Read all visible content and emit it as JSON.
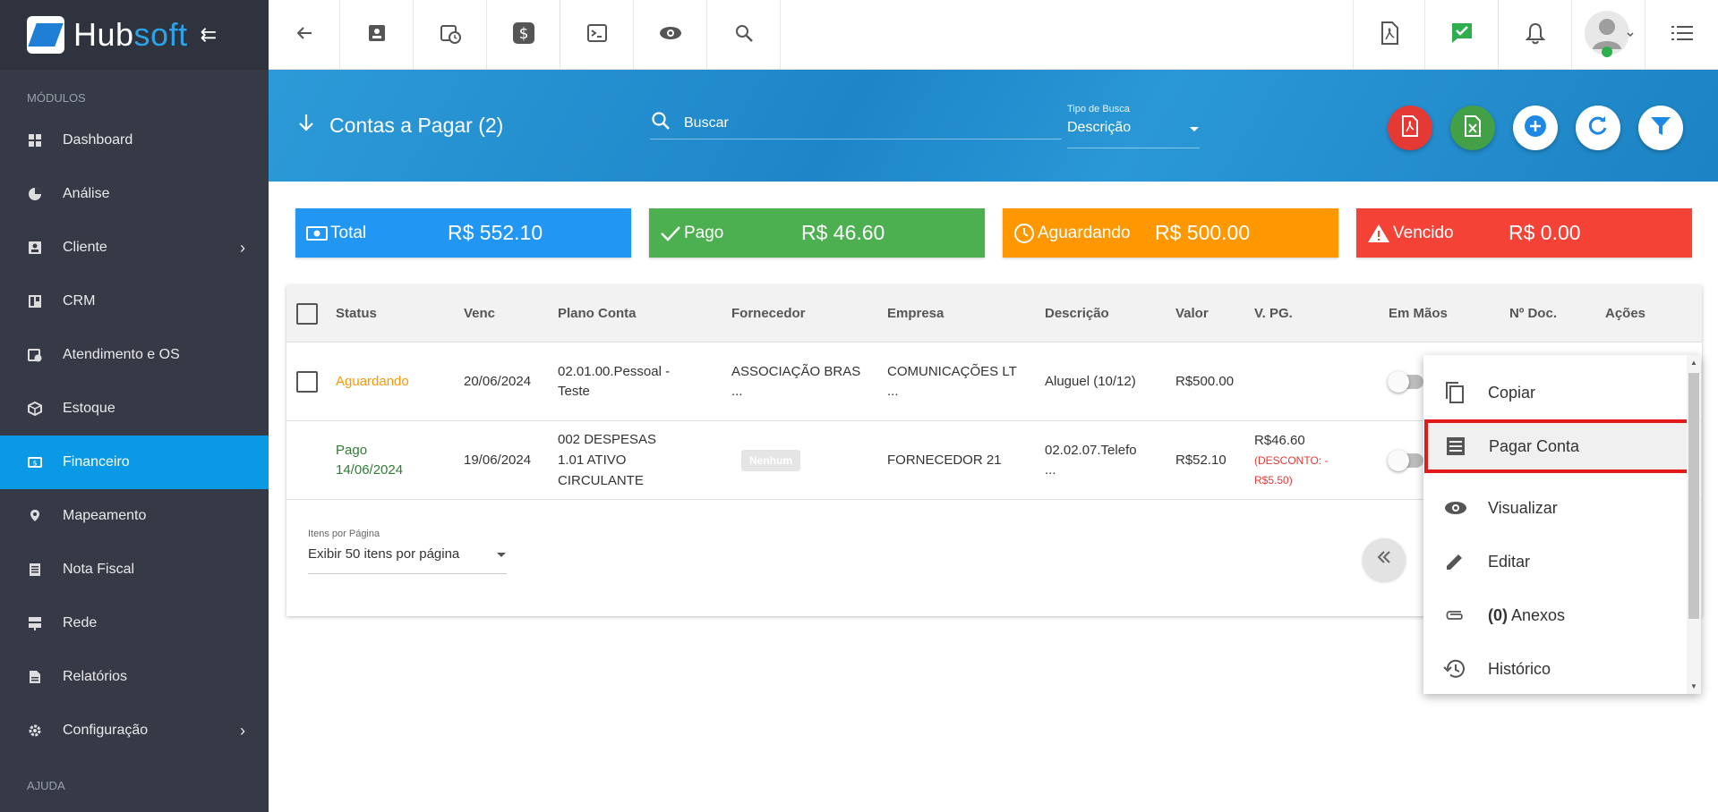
{
  "brand": {
    "name_a": "Hub",
    "name_b": "soft",
    "colors": {
      "sidebar": "#353a46",
      "active": "#0a9ae5",
      "header": "#2290d2"
    }
  },
  "sidebar": {
    "section_modules": "MÓDULOS",
    "section_help": "AJUDA",
    "items": [
      {
        "label": "Dashboard",
        "icon": "dashboard-icon"
      },
      {
        "label": "Análise",
        "icon": "pie-chart-icon"
      },
      {
        "label": "Cliente",
        "icon": "contact-card-icon",
        "has_children": true
      },
      {
        "label": "CRM",
        "icon": "crm-board-icon"
      },
      {
        "label": "Atendimento e OS",
        "icon": "calendar-clock-icon"
      },
      {
        "label": "Estoque",
        "icon": "box-icon"
      },
      {
        "label": "Financeiro",
        "icon": "money-icon",
        "active": true
      },
      {
        "label": "Mapeamento",
        "icon": "map-pin-icon"
      },
      {
        "label": "Nota Fiscal",
        "icon": "invoice-icon"
      },
      {
        "label": "Rede",
        "icon": "network-icon"
      },
      {
        "label": "Relatórios",
        "icon": "report-icon"
      },
      {
        "label": "Configuração",
        "icon": "gear-icon",
        "has_children": true
      }
    ]
  },
  "header": {
    "title": "Contas a Pagar (2)",
    "search_placeholder": "Buscar",
    "tipo_label": "Tipo de Busca",
    "tipo_value": "Descrição"
  },
  "cards": [
    {
      "label": "Total",
      "value": "R$ 552.10",
      "color": "#2196f3",
      "icon": "cash-icon"
    },
    {
      "label": "Pago",
      "value": "R$ 46.60",
      "color": "#4caf50",
      "icon": "check-icon"
    },
    {
      "label": "Aguardando",
      "value": "R$ 500.00",
      "color": "#ff9800",
      "icon": "clock-icon"
    },
    {
      "label": "Vencido",
      "value": "R$ 0.00",
      "color": "#f44336",
      "icon": "warning-icon"
    }
  ],
  "table": {
    "headers": {
      "status": "Status",
      "venc": "Venc",
      "plano": "Plano Conta",
      "fornecedor": "Fornecedor",
      "empresa": "Empresa",
      "descricao": "Descrição",
      "valor": "Valor",
      "vpg": "V. PG.",
      "emmaos": "Em Mãos",
      "ndoc": "Nº Doc.",
      "acoes": "Ações"
    },
    "rows": [
      {
        "status": "Aguardando",
        "status_color": "#ff9800",
        "venc": "20/06/2024",
        "plano_1": "02.01.00.Pessoal -",
        "plano_2": "Teste",
        "plano_3": "",
        "fornecedor_1": "ASSOCIAÇÃO BRAS",
        "fornecedor_2": "...",
        "empresa_1": "COMUNICAÇÕES LT",
        "empresa_2": "...",
        "descricao_1": "Aluguel (10/12)",
        "descricao_2": "",
        "valor": "R$500.00",
        "vpg": "",
        "vpg_desc_1": "",
        "vpg_desc_2": ""
      },
      {
        "status": "Pago",
        "status_date": "14/06/2024",
        "status_color": "#2e7d32",
        "venc": "19/06/2024",
        "plano_1": "002 DESPESAS",
        "plano_2": "1.01 ATIVO",
        "plano_3": "CIRCULANTE",
        "fornecedor_badge": "Nenhum",
        "empresa_1": "FORNECEDOR 21",
        "empresa_2": "",
        "descricao_1": "02.02.07.Telefo",
        "descricao_2": "...",
        "valor": "R$52.10",
        "vpg": "R$46.60",
        "vpg_desc_1": "(DESCONTO: -",
        "vpg_desc_2": "R$5.50)"
      }
    ]
  },
  "pagination": {
    "label": "Itens por Página",
    "value": "Exibir 50 itens por página"
  },
  "context_menu": {
    "items": [
      {
        "label": "Copiar",
        "icon": "copy-icon"
      },
      {
        "label": "Pagar Conta",
        "icon": "pay-receipt-icon",
        "highlighted": true
      },
      {
        "label": "Visualizar",
        "icon": "eye-icon"
      },
      {
        "label": "Editar",
        "icon": "pencil-icon"
      },
      {
        "label_count": "(0)",
        "label": " Anexos",
        "icon": "paperclip-icon"
      },
      {
        "label": "Histórico",
        "icon": "history-icon"
      }
    ]
  }
}
